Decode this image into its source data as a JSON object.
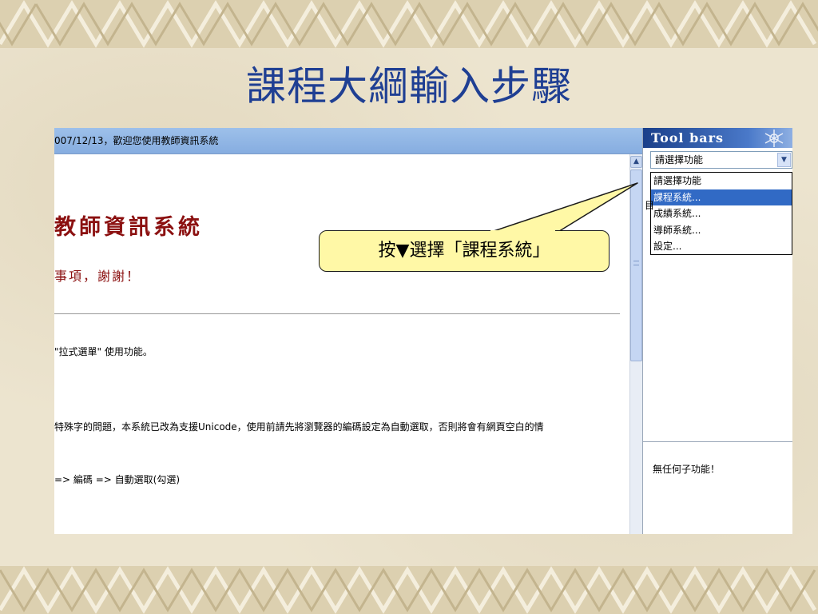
{
  "slide": {
    "title": "課程大綱輸入步驟"
  },
  "main_frame": {
    "header_text": "007/12/13，歡迎您使用教師資訊系統",
    "system_title": "教師資訊系統",
    "note_line": "事項，謝謝！",
    "body_lines": [
      "\"拉式選單\" 使用功能。",
      "特殊字的問題，本系統已改為支援Unicode，使用前請先將瀏覽器的編碼設定為自動選取，否則將會有網頁空白的情",
      "=> 編碼 => 自動選取(勾選)"
    ]
  },
  "tool_panel": {
    "header": "Tool bars",
    "select_value": "請選擇功能",
    "options": [
      "請選擇功能",
      "課程系統...",
      "成績系統...",
      "導師系統...",
      "設定..."
    ],
    "selected_index": 1,
    "cut_char": "目",
    "subfunc_text": "無任何子功能！"
  },
  "callout": {
    "text": "按▼選擇「課程系統」"
  },
  "colors": {
    "title": "#1f3f93",
    "system_title": "#8b1010",
    "tool_header": "#1a3f8a",
    "selected_option": "#316ac5",
    "callout_fill": "#fff8a6"
  }
}
